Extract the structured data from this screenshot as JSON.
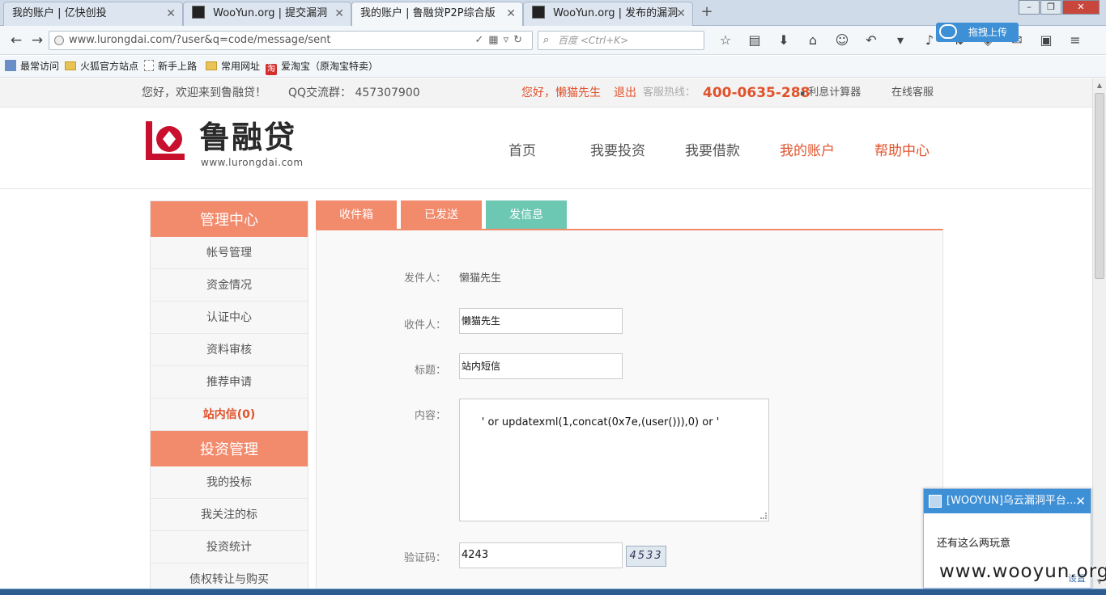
{
  "browser": {
    "tabs": [
      {
        "label": "我的账户 | 亿快创投",
        "active": false
      },
      {
        "label": "WooYun.org | 提交漏洞",
        "active": false
      },
      {
        "label": "我的账户 | 鲁融贷P2P综合版",
        "active": true
      },
      {
        "label": "WooYun.org | 发布的漏洞",
        "active": false
      }
    ],
    "new_tab": "+",
    "url": "www.lurongdai.com/?user&q=code/message/sent",
    "search_placeholder": "百度 <Ctrl+K>",
    "upload_label": "拖拽上传",
    "bookmarks": [
      "最常访问",
      "火狐官方站点",
      "新手上路",
      "常用网址",
      "爱淘宝（原淘宝特卖）"
    ],
    "taobao_glyph": "淘"
  },
  "site": {
    "welcome": "您好，欢迎来到鲁融贷！",
    "qq_group": "QQ交流群：  457307900",
    "user_greeting": "您好，懒猫先生",
    "logout": "退出",
    "hotline_label": "客服热线：",
    "hotline": "400-0635-288",
    "calculator": "利息计算器",
    "online_service": "在线客服",
    "logo_text": "鲁融贷",
    "logo_url": "www.lurongdai.com",
    "nav": [
      {
        "label": "首页",
        "active": false
      },
      {
        "label": "我要投资",
        "active": false
      },
      {
        "label": "我要借款",
        "active": false
      },
      {
        "label": "我的账户",
        "active": true
      },
      {
        "label": "帮助中心",
        "active": true
      }
    ]
  },
  "sidebar": {
    "section1_title": "管理中心",
    "section1_items": [
      {
        "label": "帐号管理",
        "active": false
      },
      {
        "label": "资金情况",
        "active": false
      },
      {
        "label": "认证中心",
        "active": false
      },
      {
        "label": "资料审核",
        "active": false
      },
      {
        "label": "推荐申请",
        "active": false
      },
      {
        "label": "站内信(0)",
        "active": true
      }
    ],
    "section2_title": "投资管理",
    "section2_items": [
      {
        "label": "我的投标"
      },
      {
        "label": "我关注的标"
      },
      {
        "label": "投资统计"
      },
      {
        "label": "债权转让与购买"
      }
    ]
  },
  "message": {
    "tabs": [
      "收件箱",
      "已发送",
      "发信息"
    ],
    "sender_label": "发件人：",
    "sender": "懒猫先生",
    "recipient_label": "收件人：",
    "recipient": "懒猫先生",
    "subject_label": "标题：",
    "subject": "站内短信",
    "content_label": "内容：",
    "content": "' or updatexml(1,concat(0x7e,(user())),0) or '",
    "captcha_label": "验证码：",
    "captcha_value": "4243",
    "captcha_image": "4533"
  },
  "notification": {
    "title": "[WOOYUN]乌云漏洞平台...",
    "body": "还有这么两玩意",
    "settings": "设置"
  },
  "watermark": "www.wooyun.org",
  "colors": {
    "accent_orange": "#f28a6c",
    "accent_green": "#6cc7b3",
    "brand_red": "#e0522b"
  }
}
